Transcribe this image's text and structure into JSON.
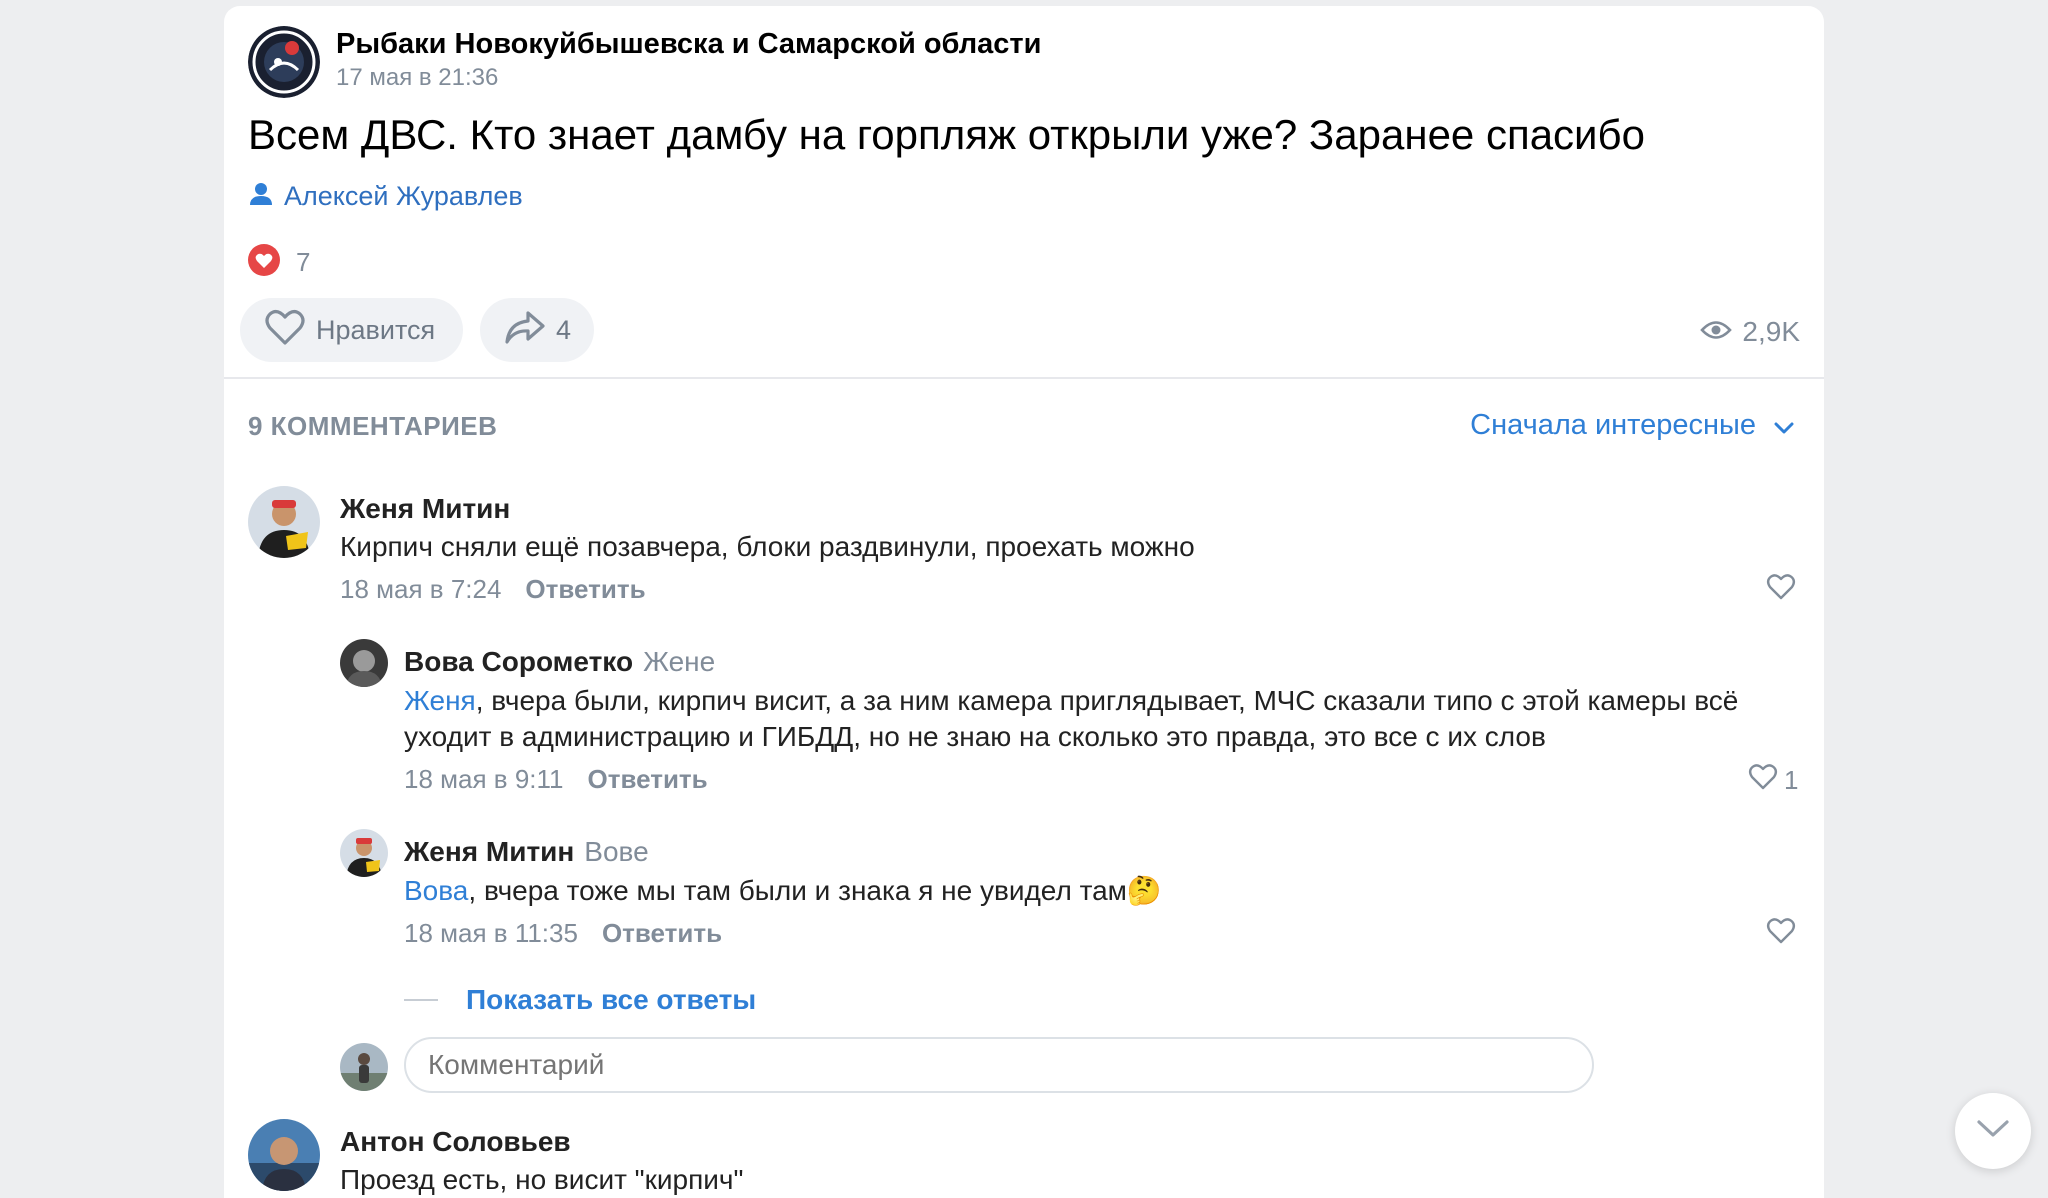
{
  "post": {
    "group_name": "Рыбаки Новокуйбышевска и Самарской области",
    "date": "17 мая в 21:36",
    "text": "Всем ДВС. Кто знает дамбу на горпляж открыли уже? Заранее спасибо",
    "author": "Алексей Журавлев",
    "reactions_count": "7",
    "like_label": "Нравится",
    "share_count": "4",
    "views": "2,9K"
  },
  "comments_section": {
    "count_label": "9 КОММЕНТАРИЕВ",
    "sort_label": "Сначала интересные",
    "show_all_label": "Показать все ответы",
    "input_placeholder": "Комментарий"
  },
  "comments": [
    {
      "name": "Женя Митин",
      "text": "Кирпич сняли ещё позавчера, блоки раздвинули, проехать можно",
      "date": "18 мая в 7:24",
      "reply_label": "Ответить"
    },
    {
      "name": "Антон Соловьев",
      "text": "Проезд есть, но висит \"кирпич\""
    }
  ],
  "replies": [
    {
      "name": "Вова Сорометко",
      "to": "Жене",
      "mention": "Женя",
      "text": ", вчера были, кирпич висит, а за ним камера приглядывает, МЧС сказали типо с этой камеры всё уходит в администрацию и ГИБДД, но не знаю на сколько это правда, это все с их слов",
      "date": "18 мая в 9:11",
      "reply_label": "Ответить",
      "likes": "1"
    },
    {
      "name": "Женя Митин",
      "to": "Вове",
      "mention": "Вова",
      "text": ", вчера тоже мы там были и знака я не увидел там",
      "emoji": "🤔",
      "date": "18 мая в 11:35",
      "reply_label": "Ответить"
    }
  ],
  "colors": {
    "accent": "#2f7fd6",
    "heart_red": "#e64646",
    "muted": "#818c99",
    "background": "#edeef0"
  }
}
